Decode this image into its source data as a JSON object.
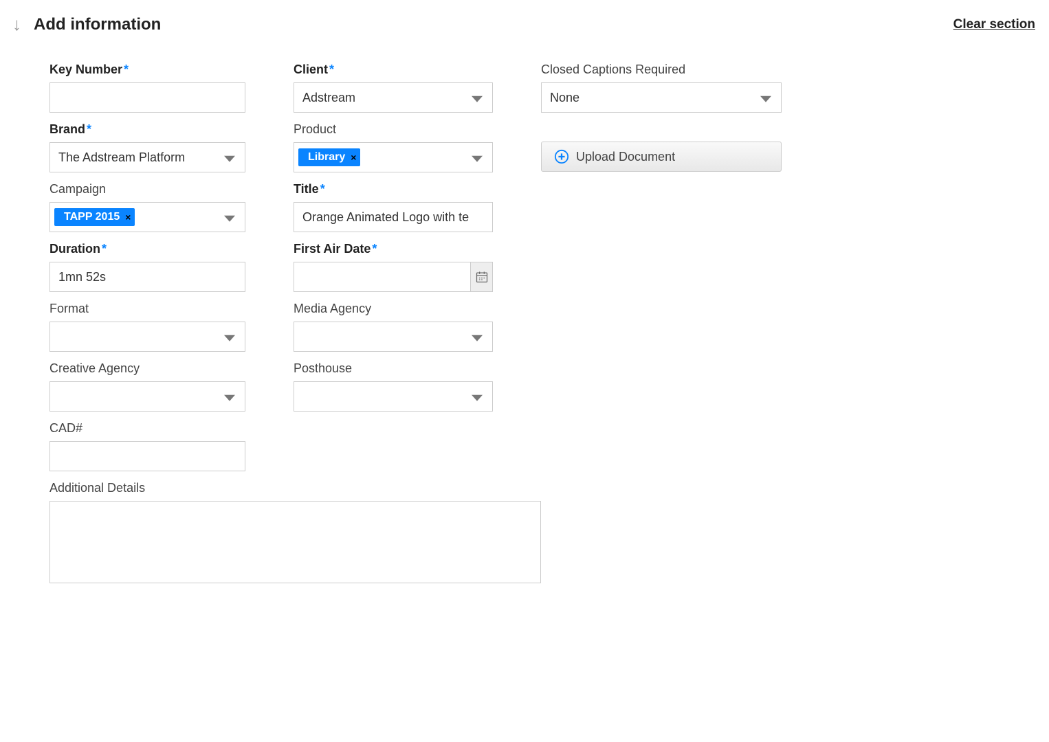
{
  "header": {
    "title": "Add information",
    "clear_link": "Clear section"
  },
  "col1": {
    "key_number": {
      "label": "Key Number",
      "value": ""
    },
    "brand": {
      "label": "Brand",
      "value": "The Adstream Platform"
    },
    "campaign": {
      "label": "Campaign",
      "tag": "TAPP 2015"
    },
    "duration": {
      "label": "Duration",
      "value": "1mn 52s"
    },
    "format": {
      "label": "Format",
      "value": ""
    },
    "creative_agency": {
      "label": "Creative Agency",
      "value": ""
    },
    "cad": {
      "label": "CAD#",
      "value": ""
    },
    "additional_details": {
      "label": "Additional Details",
      "value": ""
    }
  },
  "col2": {
    "client": {
      "label": "Client",
      "value": "Adstream"
    },
    "product": {
      "label": "Product",
      "tag": "Library"
    },
    "title": {
      "label": "Title",
      "value": "Orange Animated Logo with te"
    },
    "first_air_date": {
      "label": "First Air Date",
      "value": ""
    },
    "media_agency": {
      "label": "Media Agency",
      "value": ""
    },
    "posthouse": {
      "label": "Posthouse",
      "value": ""
    }
  },
  "col3": {
    "closed_captions": {
      "label": "Closed Captions Required",
      "value": "None"
    },
    "upload_label": "Upload Document"
  }
}
